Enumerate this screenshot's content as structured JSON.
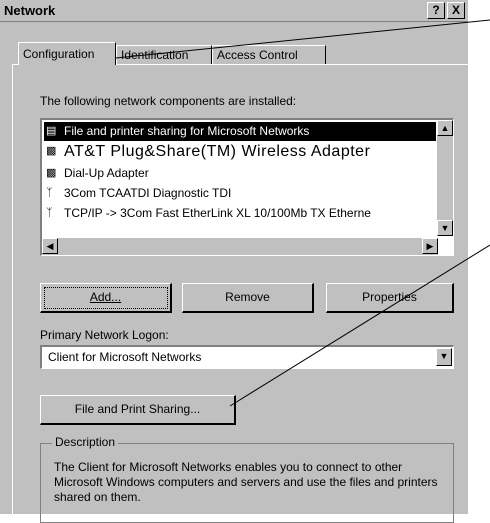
{
  "dialog": {
    "title": "Network",
    "help_label": "?",
    "close_label": "X"
  },
  "tabs": [
    {
      "label": "Configuration",
      "active": true
    },
    {
      "label": "Identification",
      "active": false
    },
    {
      "label": "Access Control",
      "active": false
    }
  ],
  "components": {
    "heading": "The following network components are installed:",
    "items": [
      {
        "label": "File and printer sharing for Microsoft Networks",
        "icon": "service-icon",
        "selected": true
      },
      {
        "label": "AT&T Plug&Share(TM) Wireless Adapter",
        "icon": "adapter-icon",
        "selected": false
      },
      {
        "label": "Dial-Up Adapter",
        "icon": "adapter-icon",
        "selected": false
      },
      {
        "label": "3Com TCAATDI Diagnostic TDI",
        "icon": "protocol-icon",
        "selected": false
      },
      {
        "label": "TCP/IP -> 3Com Fast EtherLink XL 10/100Mb TX Etherne",
        "icon": "protocol-icon",
        "selected": false
      }
    ]
  },
  "buttons": {
    "add": "Add...",
    "remove": "Remove",
    "properties": "Properties",
    "file_print_sharing": "File and Print Sharing..."
  },
  "logon": {
    "label": "Primary Network Logon:",
    "value": "Client for Microsoft Networks"
  },
  "description": {
    "legend": "Description",
    "text": "The Client for Microsoft Networks enables you to connect to other Microsoft Windows computers and servers and use the files and printers shared on them."
  },
  "colors": {
    "window": "#c0c0c0",
    "selection": "#000000"
  }
}
